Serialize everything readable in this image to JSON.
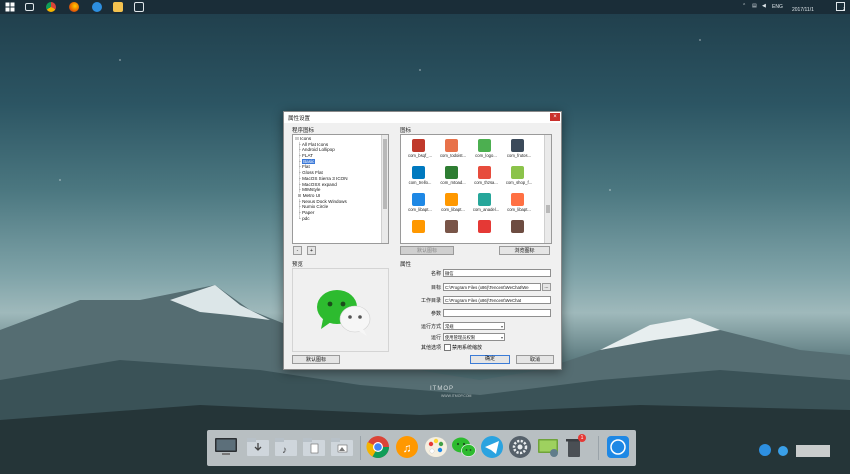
{
  "taskbar": {
    "tray_text": "ENG",
    "clock_time": "",
    "clock_date": "2017/11/1",
    "notification_count": "2"
  },
  "dialog": {
    "title": "属性设置",
    "close_label": "×",
    "tree_group_label": "程序图标",
    "icon_group_label": "图标",
    "preview_label": "预览",
    "props_group_label": "属性",
    "tree_items": [
      {
        "label": "Icons",
        "prefix": "⊟ "
      },
      {
        "label": "All Flat Icons",
        "prefix": "  ├ "
      },
      {
        "label": "Android Lollipop",
        "prefix": "  ├ "
      },
      {
        "label": "FLAT",
        "prefix": "  ├ "
      },
      {
        "label": "Basic",
        "prefix": "  ├ "
      },
      {
        "label": "Flat",
        "prefix": "  ├ "
      },
      {
        "label": "Gloss Flat",
        "prefix": "  ├ "
      },
      {
        "label": "MacOS Sierra 3 ICON",
        "prefix": "  ├ "
      },
      {
        "label": "MacOSX expand",
        "prefix": "  ├ "
      },
      {
        "label": "MIMstyle",
        "prefix": "  ├ "
      },
      {
        "label": "Metro UI",
        "prefix": "  ⊞ "
      },
      {
        "label": "Nexus Dock Windows",
        "prefix": "  ├ "
      },
      {
        "label": "Numix Circle",
        "prefix": "  ├ "
      },
      {
        "label": "Paper",
        "prefix": "  ├ "
      },
      {
        "label": "pdc",
        "prefix": "  └ "
      }
    ],
    "tree_minus": "-",
    "tree_plus": "+",
    "icons": [
      {
        "label": "com_bsqf_...",
        "color": "#c0392b"
      },
      {
        "label": "com_todoist...",
        "color": "#e8724a"
      },
      {
        "label": "com_logo...",
        "color": "#4caf50"
      },
      {
        "label": "com_frutos...",
        "color": "#3b4a5a"
      },
      {
        "label": "com_trello...",
        "color": "#0079bf"
      },
      {
        "label": "com_mtoad...",
        "color": "#2e7d32"
      },
      {
        "label": "com_thzsa...",
        "color": "#e74c3c"
      },
      {
        "label": "com_shop_f...",
        "color": "#8bc34a"
      },
      {
        "label": "com_libapt...",
        "color": "#1e88e5"
      },
      {
        "label": "com_libapt...",
        "color": "#ff9800"
      },
      {
        "label": "com_anadel...",
        "color": "#26a69a"
      },
      {
        "label": "com_libapt...",
        "color": "#ff7043"
      },
      {
        "label": "",
        "color": "#ff9800"
      },
      {
        "label": "",
        "color": "#795548"
      },
      {
        "label": "",
        "color": "#e53935"
      },
      {
        "label": "",
        "color": "#6d4c41"
      }
    ],
    "default_icon_btn": "默认图标",
    "browse_btn": "浏览图标",
    "props": {
      "name_label": "名称",
      "name_value": "微信",
      "target_label": "目标",
      "target_value": "C:\\Program Files (x86)\\Tencent\\WeChat\\We",
      "workdir_label": "工作目录",
      "workdir_value": "C:\\Program Files (x86)\\Tencent\\WeChat",
      "args_label": "参数",
      "args_value": "",
      "run_mode_label": "运行方式",
      "run_mode_value": "常规",
      "run_label": "运行",
      "run_value": "使用管理员权限",
      "advanced_label": "其他选项",
      "advanced_value": "禁用系统缩放",
      "browse_dots": "..."
    },
    "restore_default_btn": "默认图标",
    "ok_btn": "确定",
    "cancel_btn": "取消"
  },
  "watermark": "ITMOP",
  "watermark_sub": "WWW.ITMOP.COM",
  "dock_badge": "1",
  "colors": {
    "accent": "#3b7bd6",
    "wechat": "#2dbb2f",
    "taskbar": "#1a2d38"
  }
}
